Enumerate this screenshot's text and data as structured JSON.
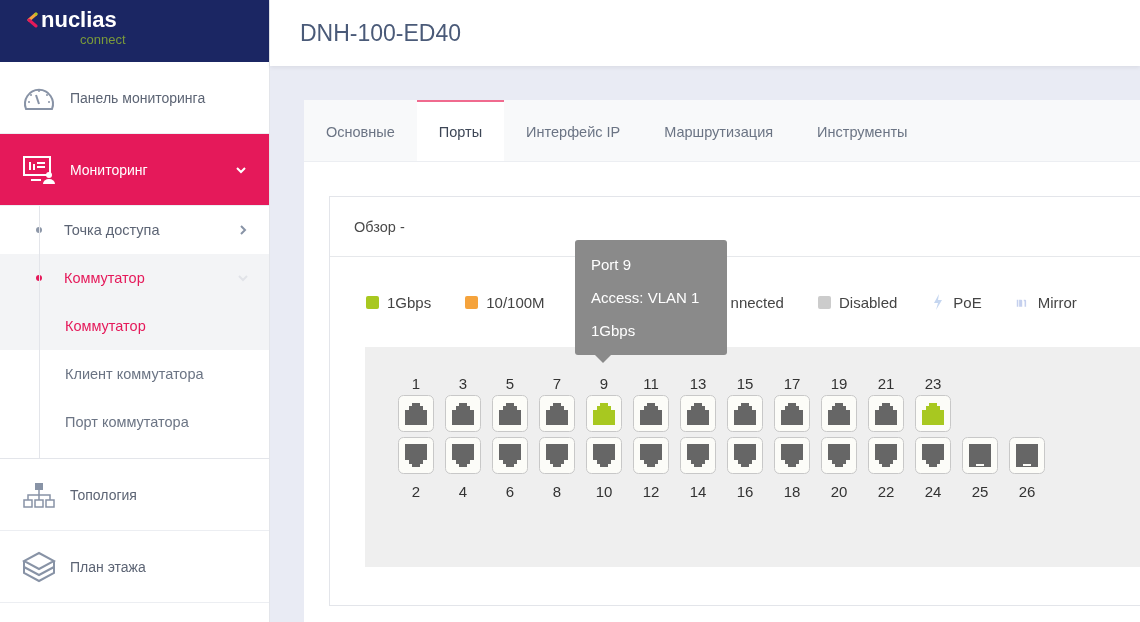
{
  "logo": {
    "name": "nuclias",
    "sub": "connect"
  },
  "header": {
    "title": "DNH-100-ED40"
  },
  "sidebar": {
    "items": [
      {
        "label": "Панель мониторинга",
        "selected": false
      },
      {
        "label": "Мониторинг",
        "selected": true,
        "expanded": true,
        "children": [
          {
            "label": "Точка доступа",
            "selected": false,
            "expanded": false
          },
          {
            "label": "Коммутатор",
            "selected": true,
            "expanded": true,
            "children": [
              {
                "label": "Коммутатор",
                "selected": true
              },
              {
                "label": "Клиент коммутатора",
                "selected": false
              },
              {
                "label": "Порт коммутатора",
                "selected": false
              }
            ]
          }
        ]
      },
      {
        "label": "Топология",
        "selected": false
      },
      {
        "label": "План этажа",
        "selected": false
      }
    ]
  },
  "tabs": [
    {
      "label": "Основные",
      "selected": false
    },
    {
      "label": "Порты",
      "selected": true
    },
    {
      "label": "Интерфейс IP",
      "selected": false
    },
    {
      "label": "Маршрутизация",
      "selected": false
    },
    {
      "label": "Инструменты",
      "selected": false
    }
  ],
  "panel": {
    "title": "Обзор -",
    "legend": [
      {
        "kind": "swatch",
        "label": "1Gbps",
        "color": "#a8c820"
      },
      {
        "kind": "swatch",
        "label": "10/100M",
        "color": "#f5a33c"
      },
      {
        "kind": "covered",
        "label": "nnected"
      },
      {
        "kind": "swatch",
        "label": "Disabled",
        "color": "#cccccc"
      },
      {
        "kind": "poe",
        "label": "PoE"
      },
      {
        "kind": "mirror",
        "label": "Mirror"
      }
    ],
    "top_row": [
      {
        "number": "1",
        "kind": "rj45",
        "color": "#666666"
      },
      {
        "number": "3",
        "kind": "rj45",
        "color": "#666666"
      },
      {
        "number": "5",
        "kind": "rj45",
        "color": "#666666"
      },
      {
        "number": "7",
        "kind": "rj45",
        "color": "#666666"
      },
      {
        "number": "9",
        "kind": "rj45",
        "color": "#a8c820",
        "tooltip": [
          "Port 9",
          "Access: VLAN 1",
          "1Gbps"
        ]
      },
      {
        "number": "11",
        "kind": "rj45",
        "color": "#666666"
      },
      {
        "number": "13",
        "kind": "rj45",
        "color": "#666666"
      },
      {
        "number": "15",
        "kind": "rj45",
        "color": "#666666"
      },
      {
        "number": "17",
        "kind": "rj45",
        "color": "#666666"
      },
      {
        "number": "19",
        "kind": "rj45",
        "color": "#666666"
      },
      {
        "number": "21",
        "kind": "rj45",
        "color": "#666666"
      },
      {
        "number": "23",
        "kind": "rj45",
        "color": "#a8c820"
      }
    ],
    "bottom_row": [
      {
        "number": "2",
        "kind": "rj45",
        "color": "#666666"
      },
      {
        "number": "4",
        "kind": "rj45",
        "color": "#666666"
      },
      {
        "number": "6",
        "kind": "rj45",
        "color": "#666666"
      },
      {
        "number": "8",
        "kind": "rj45",
        "color": "#666666"
      },
      {
        "number": "10",
        "kind": "rj45",
        "color": "#666666"
      },
      {
        "number": "12",
        "kind": "rj45",
        "color": "#666666"
      },
      {
        "number": "14",
        "kind": "rj45",
        "color": "#666666"
      },
      {
        "number": "16",
        "kind": "rj45",
        "color": "#666666"
      },
      {
        "number": "18",
        "kind": "rj45",
        "color": "#666666"
      },
      {
        "number": "20",
        "kind": "rj45",
        "color": "#666666"
      },
      {
        "number": "22",
        "kind": "rj45",
        "color": "#666666"
      },
      {
        "number": "24",
        "kind": "rj45",
        "color": "#666666"
      },
      {
        "number": "25",
        "kind": "sfp",
        "color": "#666666"
      },
      {
        "number": "26",
        "kind": "sfp",
        "color": "#666666"
      }
    ]
  }
}
